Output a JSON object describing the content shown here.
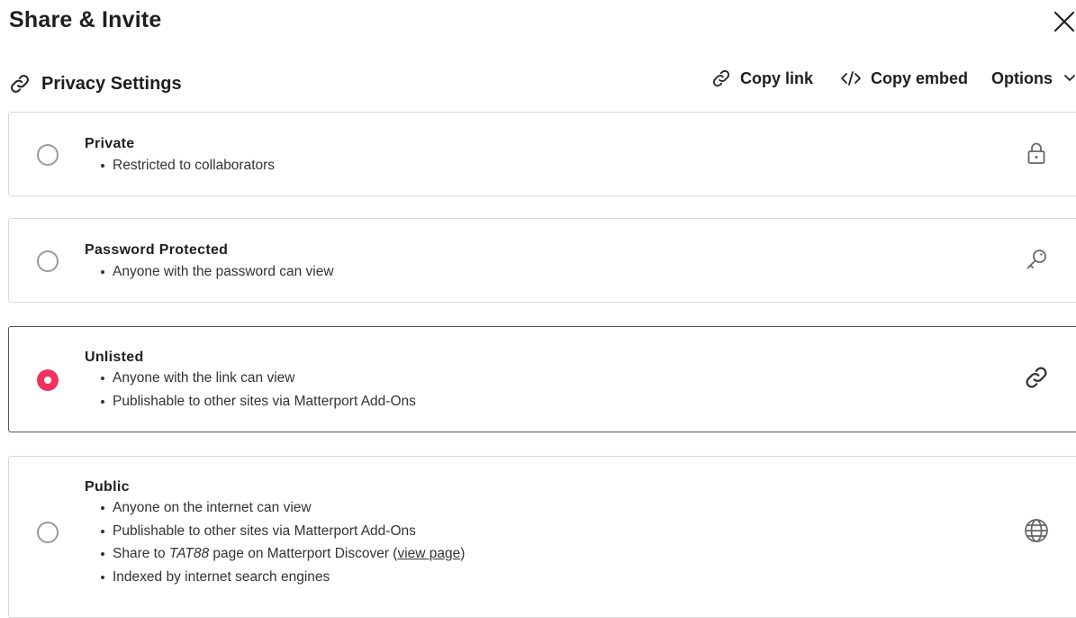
{
  "dialog": {
    "title": "Share & Invite"
  },
  "privacy": {
    "heading": "Privacy Settings",
    "heading_icon": "link-icon"
  },
  "toolbar": {
    "copy_link": "Copy link",
    "copy_embed": "Copy embed",
    "options": "Options"
  },
  "options": [
    {
      "title": "Private",
      "selected": false,
      "icon": "lock-icon",
      "bullets": [
        "Restricted to collaborators"
      ]
    },
    {
      "title": "Password Protected",
      "selected": false,
      "icon": "key-icon",
      "bullets": [
        "Anyone with the password can view"
      ]
    },
    {
      "title": "Unlisted",
      "selected": true,
      "icon": "link-icon",
      "bullets": [
        "Anyone with the link can view",
        "Publishable to other sites via Matterport Add-Ons"
      ]
    },
    {
      "title": "Public",
      "selected": false,
      "icon": "globe-icon",
      "bullets": [
        "Anyone on the internet can view",
        "Publishable to other sites via Matterport Add-Ons",
        "Share to TAT88 page on Matterport Discover (view page)",
        "Indexed by internet search engines"
      ],
      "share_prefix": "Share to ",
      "space_name": "TAT88",
      "share_suffix": " page on Matterport Discover (",
      "view_page_link": "view page",
      "share_close": ")"
    }
  ],
  "colors": {
    "accent": "#f0325d",
    "selected_border": "#555555",
    "card_border": "#d8d8d8"
  }
}
